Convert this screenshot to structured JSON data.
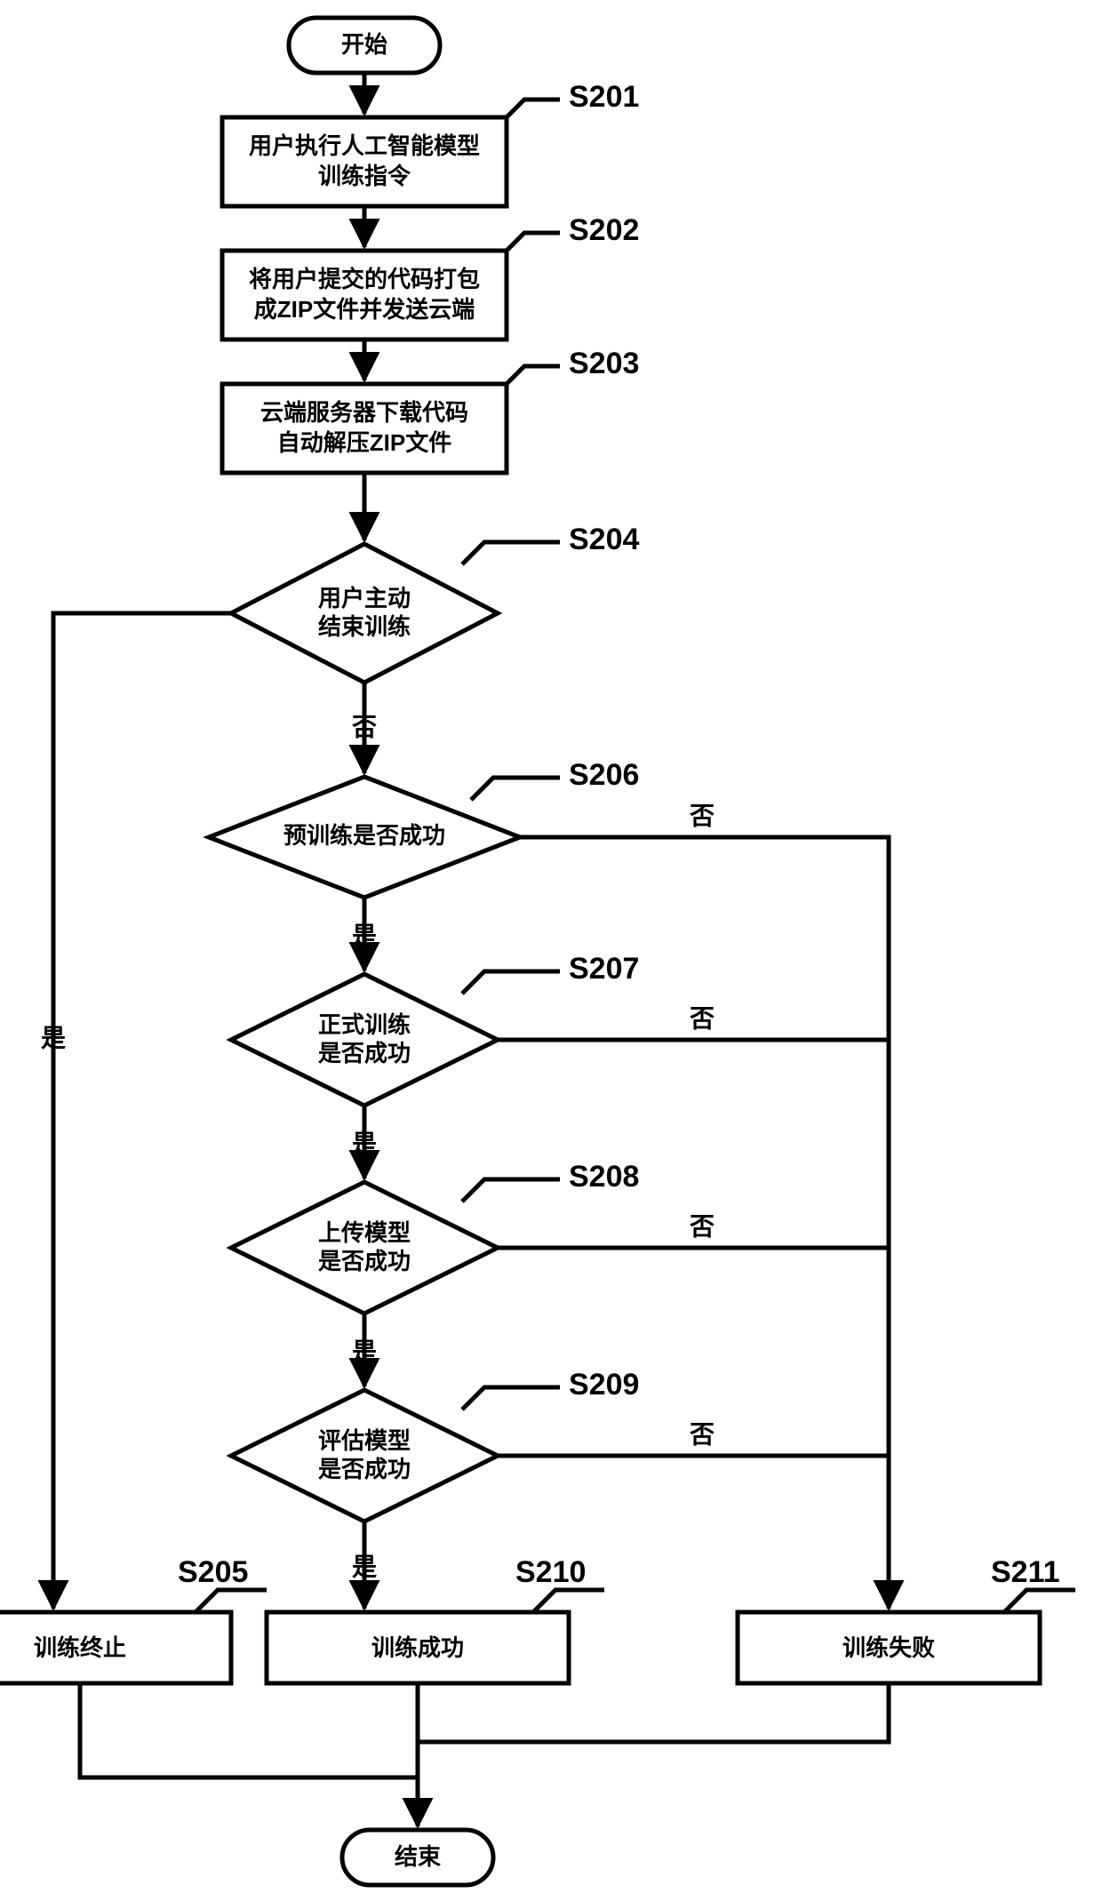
{
  "chart_data": {
    "type": "flowchart",
    "title": "",
    "nodes": [
      {
        "id": "start",
        "kind": "terminator",
        "text": "开始"
      },
      {
        "id": "s201",
        "kind": "process",
        "label": "S201",
        "lines": [
          "用户执行人工智能模型",
          "训练指令"
        ]
      },
      {
        "id": "s202",
        "kind": "process",
        "label": "S202",
        "lines": [
          "将用户提交的代码打包",
          "成ZIP文件并发送云端"
        ]
      },
      {
        "id": "s203",
        "kind": "process",
        "label": "S203",
        "lines": [
          "云端服务器下载代码",
          "自动解压ZIP文件"
        ]
      },
      {
        "id": "s204",
        "kind": "decision",
        "label": "S204",
        "lines": [
          "用户主动",
          "结束训练"
        ]
      },
      {
        "id": "s206",
        "kind": "decision",
        "label": "S206",
        "lines": [
          "预训练是否成功"
        ]
      },
      {
        "id": "s207",
        "kind": "decision",
        "label": "S207",
        "lines": [
          "正式训练",
          "是否成功"
        ]
      },
      {
        "id": "s208",
        "kind": "decision",
        "label": "S208",
        "lines": [
          "上传模型",
          "是否成功"
        ]
      },
      {
        "id": "s209",
        "kind": "decision",
        "label": "S209",
        "lines": [
          "评估模型",
          "是否成功"
        ]
      },
      {
        "id": "s205",
        "kind": "process",
        "label": "S205",
        "lines": [
          "训练终止"
        ]
      },
      {
        "id": "s210",
        "kind": "process",
        "label": "S210",
        "lines": [
          "训练成功"
        ]
      },
      {
        "id": "s211",
        "kind": "process",
        "label": "S211",
        "lines": [
          "训练失败"
        ]
      },
      {
        "id": "end",
        "kind": "terminator",
        "text": "结束"
      }
    ],
    "edges": [
      {
        "from": "start",
        "to": "s201"
      },
      {
        "from": "s201",
        "to": "s202"
      },
      {
        "from": "s202",
        "to": "s203"
      },
      {
        "from": "s203",
        "to": "s204"
      },
      {
        "from": "s204",
        "to": "s206",
        "label": "否"
      },
      {
        "from": "s204",
        "to": "s205",
        "label": "是"
      },
      {
        "from": "s206",
        "to": "s207",
        "label": "是"
      },
      {
        "from": "s206",
        "to": "s211",
        "label": "否"
      },
      {
        "from": "s207",
        "to": "s208",
        "label": "是"
      },
      {
        "from": "s207",
        "to": "s211",
        "label": "否"
      },
      {
        "from": "s208",
        "to": "s209",
        "label": "是"
      },
      {
        "from": "s208",
        "to": "s211",
        "label": "否"
      },
      {
        "from": "s209",
        "to": "s210",
        "label": "是"
      },
      {
        "from": "s209",
        "to": "s211",
        "label": "否"
      },
      {
        "from": "s205",
        "to": "end"
      },
      {
        "from": "s210",
        "to": "end"
      },
      {
        "from": "s211",
        "to": "end"
      }
    ],
    "edge_labels": {
      "yes": "是",
      "no": "否"
    }
  }
}
